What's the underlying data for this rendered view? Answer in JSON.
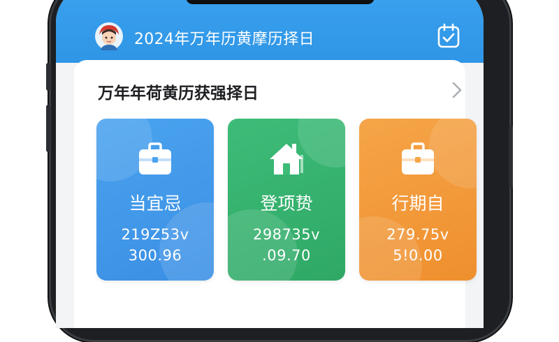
{
  "header": {
    "title": "2024年万年历黄摩历择日",
    "avatar_icon": "girl-avatar-icon",
    "calendar_icon": "calendar-check-icon",
    "color": "#3aa2ef"
  },
  "section": {
    "title": "万年年荷黄历获强择日",
    "chevron_icon": "chevron-right-icon"
  },
  "cards": [
    {
      "label": "当宜忌",
      "value1": "219Z53v",
      "value2": "300.96",
      "icon": "briefcase-icon",
      "color": "#4aa3ef"
    },
    {
      "label": "登项贽",
      "value1": "298735v",
      "value2": ".09.70",
      "icon": "house-icon",
      "color": "#3dbc78"
    },
    {
      "label": "行期自",
      "value1": "279.75v",
      "value2": "5!0.00",
      "icon": "briefcase-icon",
      "color": "#f5a548"
    }
  ]
}
